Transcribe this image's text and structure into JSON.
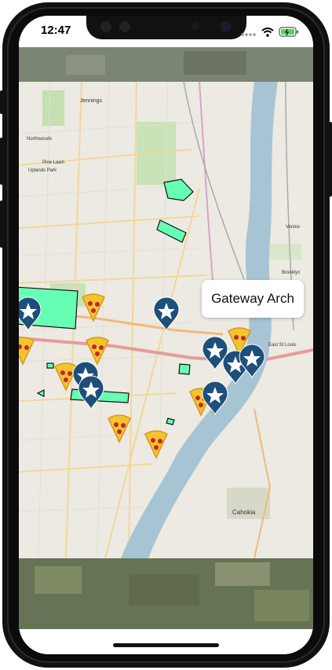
{
  "status_bar": {
    "time": "12:47",
    "icons": [
      "signal-icon",
      "wifi-icon",
      "battery-icon"
    ]
  },
  "map": {
    "base_layer": "satellite",
    "overlay": "openstreetmap-tiles",
    "legal_label": "Legal",
    "labels": {
      "jennings": "Jennings",
      "pine_lawn": "Pine Lawn",
      "northwoods": "Northwoods",
      "uplands_park": "Uplands Park",
      "venice": "Venice",
      "brooklyn": "Brooklyn",
      "cahokia": "Cahokia",
      "east_st_louis": "East St Louis"
    },
    "callout": {
      "title": "Gateway Arch"
    },
    "marker_types": {
      "star": "star-marker",
      "pizza": "pizza-marker"
    },
    "colors": {
      "star_marker": "#1e4f7a",
      "pizza_marker": "#f4c430",
      "pepperoni": "#c0272d",
      "polygon_fill": "#66ffb3",
      "polygon_stroke": "#111111",
      "river": "#a7c4d4",
      "map_bg": "#eceae2"
    }
  }
}
